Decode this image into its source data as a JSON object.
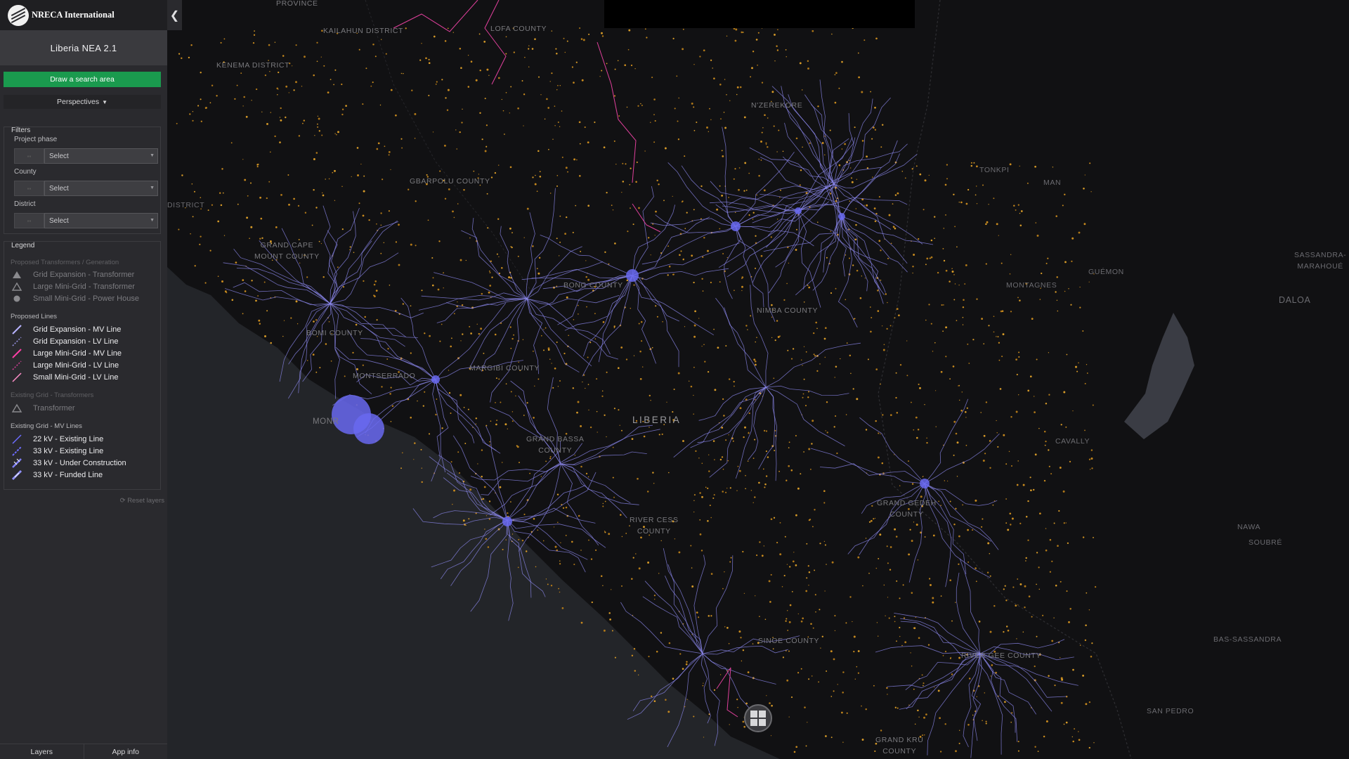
{
  "header": {
    "org_name": "NRECA International",
    "app_title": "Liberia NEA 2.1"
  },
  "actions": {
    "draw_search_area": "Draw a search area",
    "perspectives": "Perspectives"
  },
  "filters": {
    "title": "Filters",
    "fields": [
      {
        "label": "Project phase",
        "selected": "Select"
      },
      {
        "label": "County",
        "selected": "Select"
      },
      {
        "label": "District",
        "selected": "Select"
      }
    ]
  },
  "legend": {
    "title": "Legend",
    "groups": [
      {
        "title": "Proposed Transformers / Generation",
        "items": [
          {
            "label": "Grid Expansion - Transformer",
            "icon": "triangle-filled-icon",
            "color": "#8a8a8e"
          },
          {
            "label": "Large Mini-Grid - Transformer",
            "icon": "triangle-outline-icon",
            "color": "#8a8a8e"
          },
          {
            "label": "Small Mini-Grid - Power House",
            "icon": "circle-icon",
            "color": "#8a8a8e"
          }
        ]
      },
      {
        "title": "Proposed Lines",
        "items": [
          {
            "label": "Grid Expansion - MV Line",
            "icon": "solid-line-icon",
            "color": "#b8b4ff"
          },
          {
            "label": "Grid Expansion - LV Line",
            "icon": "dashed-line-icon",
            "color": "#9a96e8"
          },
          {
            "label": "Large Mini-Grid - MV Line",
            "icon": "solid-line-icon",
            "color": "#ff3fa6"
          },
          {
            "label": "Large Mini-Grid - LV Line",
            "icon": "dashed-line-icon",
            "color": "#d6409a"
          },
          {
            "label": "Small Mini-Grid - LV Line",
            "icon": "solid-line-icon",
            "color": "#ff8fc8"
          }
        ]
      },
      {
        "title": "Existing Grid - Transformers",
        "items": [
          {
            "label": "Transformer",
            "icon": "triangle-outline-icon",
            "color": "#8a8a8e"
          }
        ]
      },
      {
        "title": "Existing Grid - MV Lines",
        "items": [
          {
            "label": "22 kV - Existing Line",
            "icon": "solid-line-icon",
            "color": "#6d6dff"
          },
          {
            "label": "33 kV - Existing Line",
            "icon": "dashed-line-icon",
            "color": "#6d6dff"
          },
          {
            "label": "33 kV - Under Construction",
            "icon": "hatched-line-icon",
            "color": "#8080ff"
          },
          {
            "label": "33 kV - Funded Line",
            "icon": "hatched-line-icon",
            "color": "#9090ff"
          }
        ]
      }
    ],
    "reset_label": "Reset layers"
  },
  "bottom_tabs": [
    "Layers",
    "App info"
  ],
  "map": {
    "country_label": "LIBERIA",
    "labels": [
      "PROVINCE",
      "KAILAHUN DISTRICT",
      "LOFA COUNTY",
      "KENEMA DISTRICT",
      "N'ZEREKORE",
      "TONKPI",
      "MAN",
      "GBARPOLU COUNTY",
      "DISTRICT",
      "GRAND CAPE\nMOUNT COUNTY",
      "BONG COUNTY",
      "NIMBA COUNTY",
      "MONTAGNES",
      "GUÉMON",
      "SASSANDRA-\nMARAHOUÉ",
      "DALOA",
      "BOMI COUNTY",
      "MONTSERRADO",
      "MARGIBI COUNTY",
      "MONR",
      "GRAND BASSA\nCOUNTY",
      "CAVALLY",
      "RIVER CESS\nCOUNTY",
      "GRAND GEDEH\nCOUNTY",
      "NAWA",
      "SOUBRÉ",
      "SINOE COUNTY",
      "RIVER GEE COUNTY",
      "BAS-SASSANDRA",
      "SAN PEDRO",
      "GRAND KRU\nCOUNTY"
    ]
  }
}
